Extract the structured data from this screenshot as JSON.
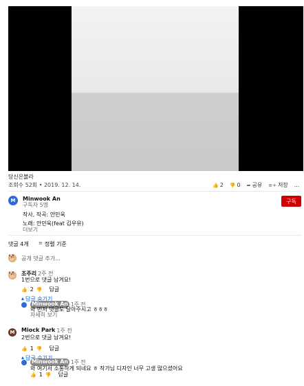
{
  "video": {
    "title": "당신은볼라",
    "meta": "조회수 52회 • 2019. 12. 14.",
    "actions": {
      "like_count": "2",
      "dislike_count": "0",
      "share_label": "공유",
      "save_label": "저장",
      "more_label": "..."
    }
  },
  "channel": {
    "avatar_letter": "M",
    "name": "Minwook An",
    "subs": "구독자 5명",
    "desc_line1": "작사, 작곡: 안민욱",
    "desc_line2": "노래: 안민욱(feat 김우유)",
    "more_label": "더보기",
    "subscribe_label": "구독"
  },
  "comments_header": {
    "count_label": "댓글 4개",
    "sort_label": "정렬 기준"
  },
  "add_comment": {
    "placeholder": "공개 댓글 추가..."
  },
  "comments": [
    {
      "author": "조주리",
      "time": "2주 전",
      "text": "1번으로 댓글 남겨요!",
      "likes": "2",
      "reply_label": "답글",
      "replies_toggle": "답글 숨기기",
      "reply": {
        "author": "Minwook An",
        "time": "1주 전",
        "text": "와 먼저 댓글도 달아주시고 ㅎㅎㅎ",
        "more_label": "자세히 보기"
      }
    },
    {
      "avatar_letter": "M",
      "author": "Miock Park",
      "time": "1주 전",
      "text": "2번으로 댓글 남겨요!",
      "likes": "1",
      "reply_label": "답글",
      "replies_toggle": "답글 숨기기",
      "reply": {
        "author": "Minwook An",
        "time": "1주 전",
        "text": "와 여기서 소통하게 되네요 ㅎ 작가님 디자인 너무 고생 많으셨어요",
        "likes": "1",
        "reply_label": "답글"
      }
    }
  ],
  "colors": {
    "subscribe_red": "#cc0000",
    "link_blue": "#065fd4",
    "channel_avatar": "#2f6bd6",
    "miock_avatar": "#6b3b2a"
  }
}
